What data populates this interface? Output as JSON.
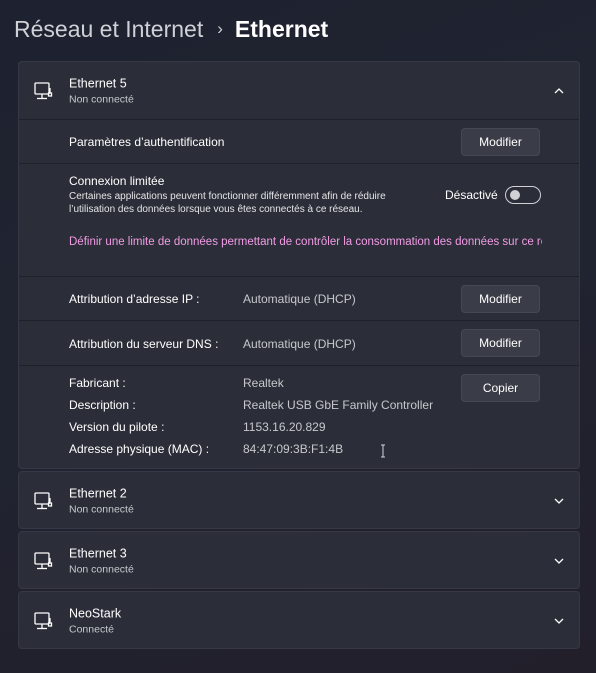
{
  "breadcrumb": {
    "parent": "Réseau et Internet",
    "separator": "›",
    "current": "Ethernet"
  },
  "expanded_adapter": {
    "name": "Ethernet 5",
    "status": "Non connecté",
    "auth": {
      "label": "Paramètres d’authentification",
      "button": "Modifier"
    },
    "metered": {
      "title": "Connexion limitée",
      "description": "Certaines applications peuvent fonctionner différemment afin de réduire l’utilisation des données lorsque vous êtes connectés à ce réseau.",
      "toggle_label": "Désactivé",
      "toggle_on": false,
      "link": "Définir une limite de données permettant de contrôler la consommation des données sur ce réseau"
    },
    "ip": {
      "label": "Attribution d’adresse IP :",
      "value": "Automatique (DHCP)",
      "button": "Modifier"
    },
    "dns": {
      "label": "Attribution du serveur DNS :",
      "value": "Automatique (DHCP)",
      "button": "Modifier"
    },
    "details": {
      "copy_button": "Copier",
      "manufacturer_label": "Fabricant :",
      "manufacturer": "Realtek",
      "description_label": "Description :",
      "description": "Realtek USB GbE Family Controller",
      "driver_label": "Version du pilote :",
      "driver": "1153.16.20.829",
      "mac_label": "Adresse physique (MAC) :",
      "mac": "84:47:09:3B:F1:4B"
    }
  },
  "adapters": [
    {
      "name": "Ethernet 2",
      "status": "Non connecté"
    },
    {
      "name": "Ethernet 3",
      "status": "Non connecté"
    },
    {
      "name": "NeoStark",
      "status": "Connecté"
    }
  ],
  "icons": {
    "adapter": "ethernet-icon",
    "expand": "chevron-down-icon",
    "collapse": "chevron-up-icon"
  },
  "colors": {
    "link": "#f29be6",
    "card": "#2b2e38",
    "background": "#202431"
  }
}
